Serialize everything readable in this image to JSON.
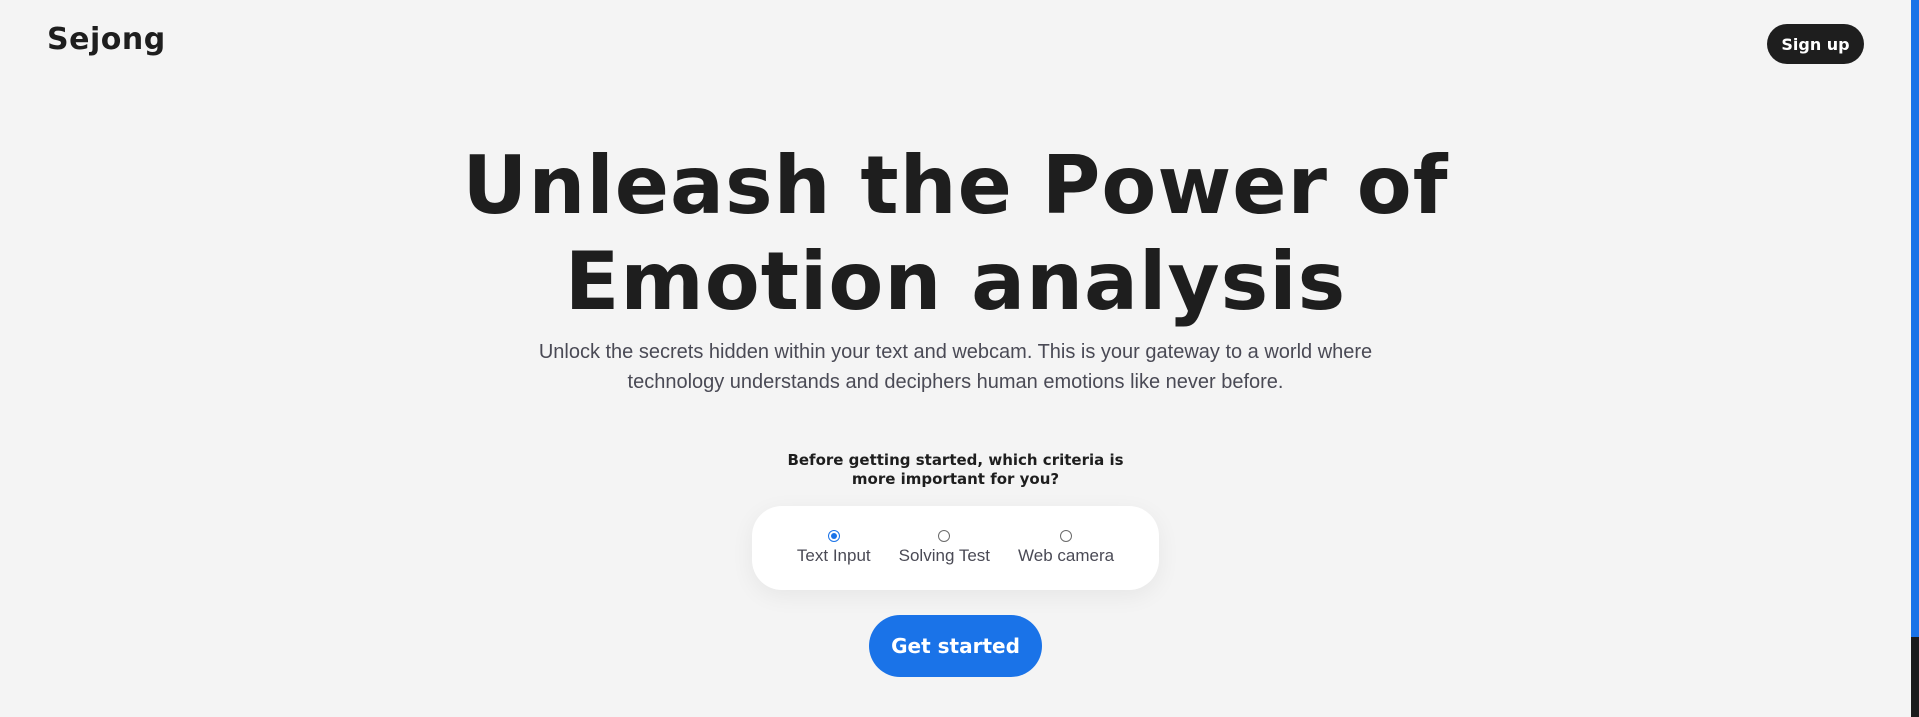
{
  "header": {
    "logo": "Sejong",
    "signup_label": "Sign up"
  },
  "hero": {
    "title_line1": "Unleash the Power of",
    "title_line2": "Emotion analysis",
    "subtitle": "Unlock the secrets hidden within your text and webcam. This is your gateway to a world where technology understands and deciphers human emotions like never before."
  },
  "criteria": {
    "question": "Before getting started, which criteria is more important for you?",
    "options": [
      {
        "label": "Text Input",
        "selected": true
      },
      {
        "label": "Solving Test",
        "selected": false
      },
      {
        "label": "Web camera",
        "selected": false
      }
    ]
  },
  "cta": {
    "label": "Get started"
  },
  "colors": {
    "accent": "#1a73e8",
    "dark": "#1e1e1e",
    "background": "#f4f4f4"
  }
}
